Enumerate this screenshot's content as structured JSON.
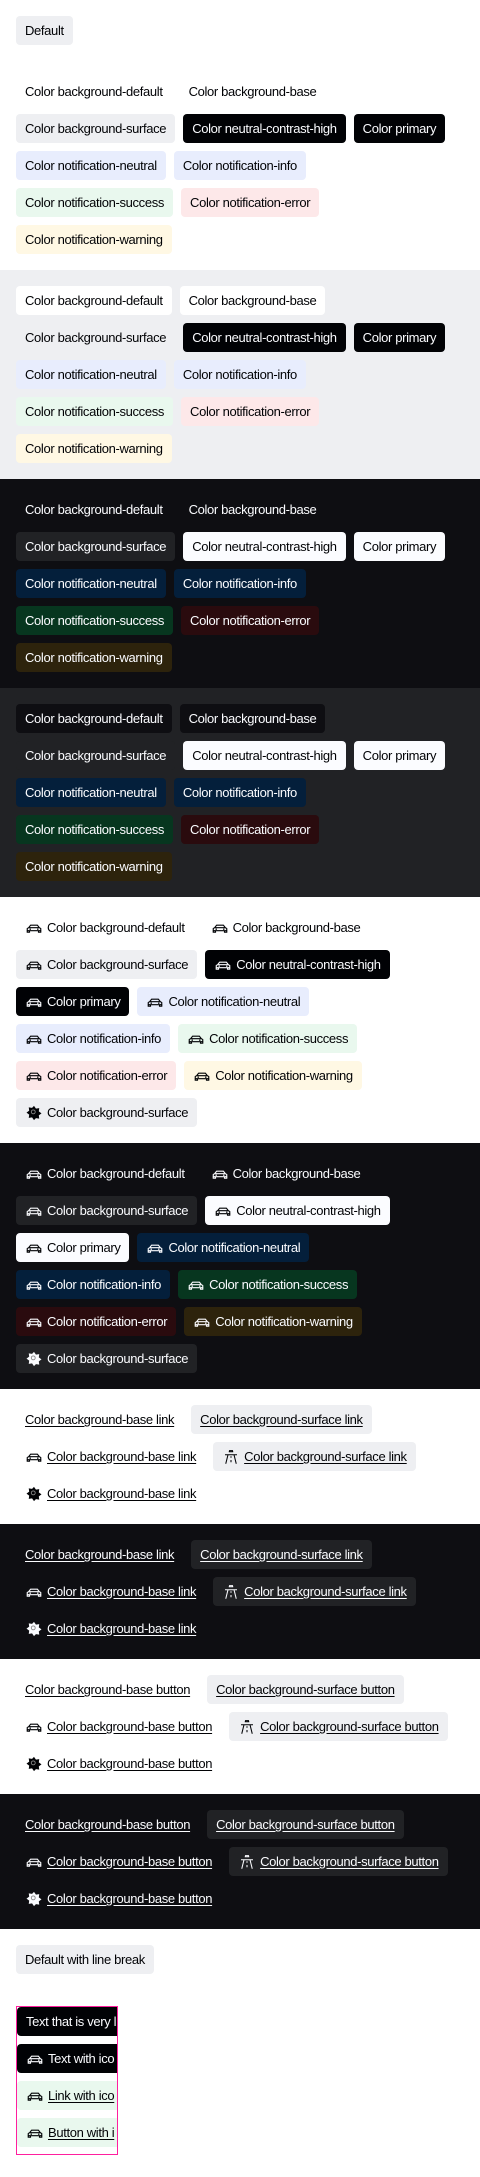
{
  "colors": {
    "pink_outline": "#ff1f9e",
    "surface": "#eeeff2",
    "dark": "#0e0e12",
    "dark_surface": "#212225",
    "primary": "#010205"
  },
  "top": {
    "label": "Default",
    "variant": "surface"
  },
  "sections": [
    {
      "theme": "light",
      "bg": "white",
      "rows": [
        [
          {
            "label": "Color background-default",
            "variant": "default"
          },
          {
            "label": "Color background-base",
            "variant": "base"
          }
        ],
        [
          {
            "label": "Color background-surface",
            "variant": "surface"
          },
          {
            "label": "Color neutral-contrast-high",
            "variant": "contrast-high"
          },
          {
            "label": "Color primary",
            "variant": "primary"
          }
        ],
        [
          {
            "label": "Color notification-neutral",
            "variant": "neutral"
          },
          {
            "label": "Color notification-info",
            "variant": "info"
          }
        ],
        [
          {
            "label": "Color notification-success",
            "variant": "success"
          },
          {
            "label": "Color notification-error",
            "variant": "error"
          }
        ],
        [
          {
            "label": "Color notification-warning",
            "variant": "warning"
          }
        ]
      ]
    },
    {
      "theme": "light",
      "bg": "surface",
      "rows": [
        [
          {
            "label": "Color background-default",
            "variant": "default"
          },
          {
            "label": "Color background-base",
            "variant": "base"
          }
        ],
        [
          {
            "label": "Color background-surface",
            "variant": "surface"
          },
          {
            "label": "Color neutral-contrast-high",
            "variant": "contrast-high"
          },
          {
            "label": "Color primary",
            "variant": "primary"
          }
        ],
        [
          {
            "label": "Color notification-neutral",
            "variant": "neutral"
          },
          {
            "label": "Color notification-info",
            "variant": "info"
          }
        ],
        [
          {
            "label": "Color notification-success",
            "variant": "success"
          },
          {
            "label": "Color notification-error",
            "variant": "error"
          }
        ],
        [
          {
            "label": "Color notification-warning",
            "variant": "warning"
          }
        ]
      ]
    },
    {
      "theme": "dark",
      "bg": "dark",
      "rows": [
        [
          {
            "label": "Color background-default",
            "variant": "default"
          },
          {
            "label": "Color background-base",
            "variant": "base"
          }
        ],
        [
          {
            "label": "Color background-surface",
            "variant": "surface"
          },
          {
            "label": "Color neutral-contrast-high",
            "variant": "contrast-high"
          },
          {
            "label": "Color primary",
            "variant": "primary"
          }
        ],
        [
          {
            "label": "Color notification-neutral",
            "variant": "neutral"
          },
          {
            "label": "Color notification-info",
            "variant": "info"
          }
        ],
        [
          {
            "label": "Color notification-success",
            "variant": "success"
          },
          {
            "label": "Color notification-error",
            "variant": "error"
          }
        ],
        [
          {
            "label": "Color notification-warning",
            "variant": "warning"
          }
        ]
      ]
    },
    {
      "theme": "dark",
      "bg": "dark-surface",
      "rows": [
        [
          {
            "label": "Color background-default",
            "variant": "default"
          },
          {
            "label": "Color background-base",
            "variant": "base"
          }
        ],
        [
          {
            "label": "Color background-surface",
            "variant": "surface"
          },
          {
            "label": "Color neutral-contrast-high",
            "variant": "contrast-high"
          },
          {
            "label": "Color primary",
            "variant": "primary"
          }
        ],
        [
          {
            "label": "Color notification-neutral",
            "variant": "neutral"
          },
          {
            "label": "Color notification-info",
            "variant": "info"
          }
        ],
        [
          {
            "label": "Color notification-success",
            "variant": "success"
          },
          {
            "label": "Color notification-error",
            "variant": "error"
          }
        ],
        [
          {
            "label": "Color notification-warning",
            "variant": "warning"
          }
        ]
      ]
    },
    {
      "theme": "light",
      "bg": "white",
      "rows": [
        [
          {
            "label": "Color background-default",
            "variant": "default",
            "icon": "car"
          },
          {
            "label": "Color background-base",
            "variant": "base",
            "icon": "car"
          }
        ],
        [
          {
            "label": "Color background-surface",
            "variant": "surface",
            "icon": "car"
          },
          {
            "label": "Color neutral-contrast-high",
            "variant": "contrast-high",
            "icon": "car"
          }
        ],
        [
          {
            "label": "Color primary",
            "variant": "primary",
            "icon": "car"
          },
          {
            "label": "Color notification-neutral",
            "variant": "neutral",
            "icon": "car"
          }
        ],
        [
          {
            "label": "Color notification-info",
            "variant": "info",
            "icon": "car"
          },
          {
            "label": "Color notification-success",
            "variant": "success",
            "icon": "car"
          }
        ],
        [
          {
            "label": "Color notification-error",
            "variant": "error",
            "icon": "car"
          },
          {
            "label": "Color notification-warning",
            "variant": "warning",
            "icon": "car"
          }
        ],
        [
          {
            "label": "Color background-surface",
            "variant": "surface",
            "icon": "star-badge"
          }
        ]
      ]
    },
    {
      "theme": "dark",
      "bg": "dark",
      "rows": [
        [
          {
            "label": "Color background-default",
            "variant": "default",
            "icon": "car"
          },
          {
            "label": "Color background-base",
            "variant": "base",
            "icon": "car"
          }
        ],
        [
          {
            "label": "Color background-surface",
            "variant": "surface",
            "icon": "car"
          },
          {
            "label": "Color neutral-contrast-high",
            "variant": "contrast-high",
            "icon": "car"
          }
        ],
        [
          {
            "label": "Color primary",
            "variant": "primary",
            "icon": "car"
          },
          {
            "label": "Color notification-neutral",
            "variant": "neutral",
            "icon": "car"
          }
        ],
        [
          {
            "label": "Color notification-info",
            "variant": "info",
            "icon": "car"
          },
          {
            "label": "Color notification-success",
            "variant": "success",
            "icon": "car"
          }
        ],
        [
          {
            "label": "Color notification-error",
            "variant": "error",
            "icon": "car"
          },
          {
            "label": "Color notification-warning",
            "variant": "warning",
            "icon": "car"
          }
        ],
        [
          {
            "label": "Color background-surface",
            "variant": "surface",
            "icon": "star-badge"
          }
        ]
      ]
    },
    {
      "theme": "light",
      "bg": "white",
      "rows": [
        [
          {
            "label": "Color background-base link",
            "variant": "base",
            "kind": "link"
          },
          {
            "label": "Color background-surface link",
            "variant": "surface",
            "kind": "link"
          }
        ],
        [
          {
            "label": "Color background-base link",
            "variant": "base",
            "kind": "link",
            "icon": "car"
          },
          {
            "label": "Color background-surface link",
            "variant": "surface",
            "kind": "link",
            "icon": "road"
          }
        ],
        [
          {
            "label": "Color background-base link",
            "variant": "base",
            "kind": "link",
            "icon": "star-badge"
          }
        ]
      ]
    },
    {
      "theme": "dark",
      "bg": "dark",
      "rows": [
        [
          {
            "label": "Color background-base link",
            "variant": "base",
            "kind": "link"
          },
          {
            "label": "Color background-surface link",
            "variant": "surface",
            "kind": "link"
          }
        ],
        [
          {
            "label": "Color background-base link",
            "variant": "base",
            "kind": "link",
            "icon": "car"
          },
          {
            "label": "Color background-surface link",
            "variant": "surface",
            "kind": "link",
            "icon": "road"
          }
        ],
        [
          {
            "label": "Color background-base link",
            "variant": "base",
            "kind": "link",
            "icon": "star-badge"
          }
        ]
      ]
    },
    {
      "theme": "light",
      "bg": "white",
      "rows": [
        [
          {
            "label": "Color background-base button",
            "variant": "base",
            "kind": "button"
          },
          {
            "label": "Color background-surface button",
            "variant": "surface",
            "kind": "button"
          }
        ],
        [
          {
            "label": "Color background-base button",
            "variant": "base",
            "kind": "button",
            "icon": "car"
          },
          {
            "label": "Color background-surface button",
            "variant": "surface",
            "kind": "button",
            "icon": "road"
          }
        ],
        [
          {
            "label": "Color background-base button",
            "variant": "base",
            "kind": "button",
            "icon": "star-badge"
          }
        ]
      ]
    },
    {
      "theme": "dark",
      "bg": "dark",
      "rows": [
        [
          {
            "label": "Color background-base button",
            "variant": "base",
            "kind": "button"
          },
          {
            "label": "Color background-surface button",
            "variant": "surface",
            "kind": "button"
          }
        ],
        [
          {
            "label": "Color background-base button",
            "variant": "base",
            "kind": "button",
            "icon": "car"
          },
          {
            "label": "Color background-surface button",
            "variant": "surface",
            "kind": "button",
            "icon": "road"
          }
        ],
        [
          {
            "label": "Color background-base button",
            "variant": "base",
            "kind": "button",
            "icon": "star-badge"
          }
        ]
      ]
    }
  ],
  "line_break": {
    "label": "Default with line break",
    "variant": "surface"
  },
  "clipped": [
    {
      "label": "Text that is very l",
      "variant": "contrast-high"
    },
    {
      "label": "Text with ico",
      "variant": "contrast-high",
      "icon": "car"
    },
    {
      "label": "Link with ico",
      "variant": "success",
      "kind": "link",
      "icon": "car"
    },
    {
      "label": "Button with i",
      "variant": "success",
      "kind": "button",
      "icon": "car"
    }
  ]
}
